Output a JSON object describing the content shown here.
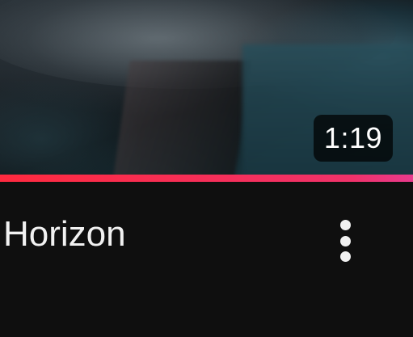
{
  "video": {
    "title": "Horizon",
    "duration": "1:19",
    "watch_progress_percent": 100
  },
  "menu": {
    "icon": "more-vertical-icon"
  },
  "colors": {
    "background": "#0f0f0f",
    "progress_start": "#ff2a3f",
    "progress_end": "#e83a8c",
    "text": "#f1f1f1"
  }
}
